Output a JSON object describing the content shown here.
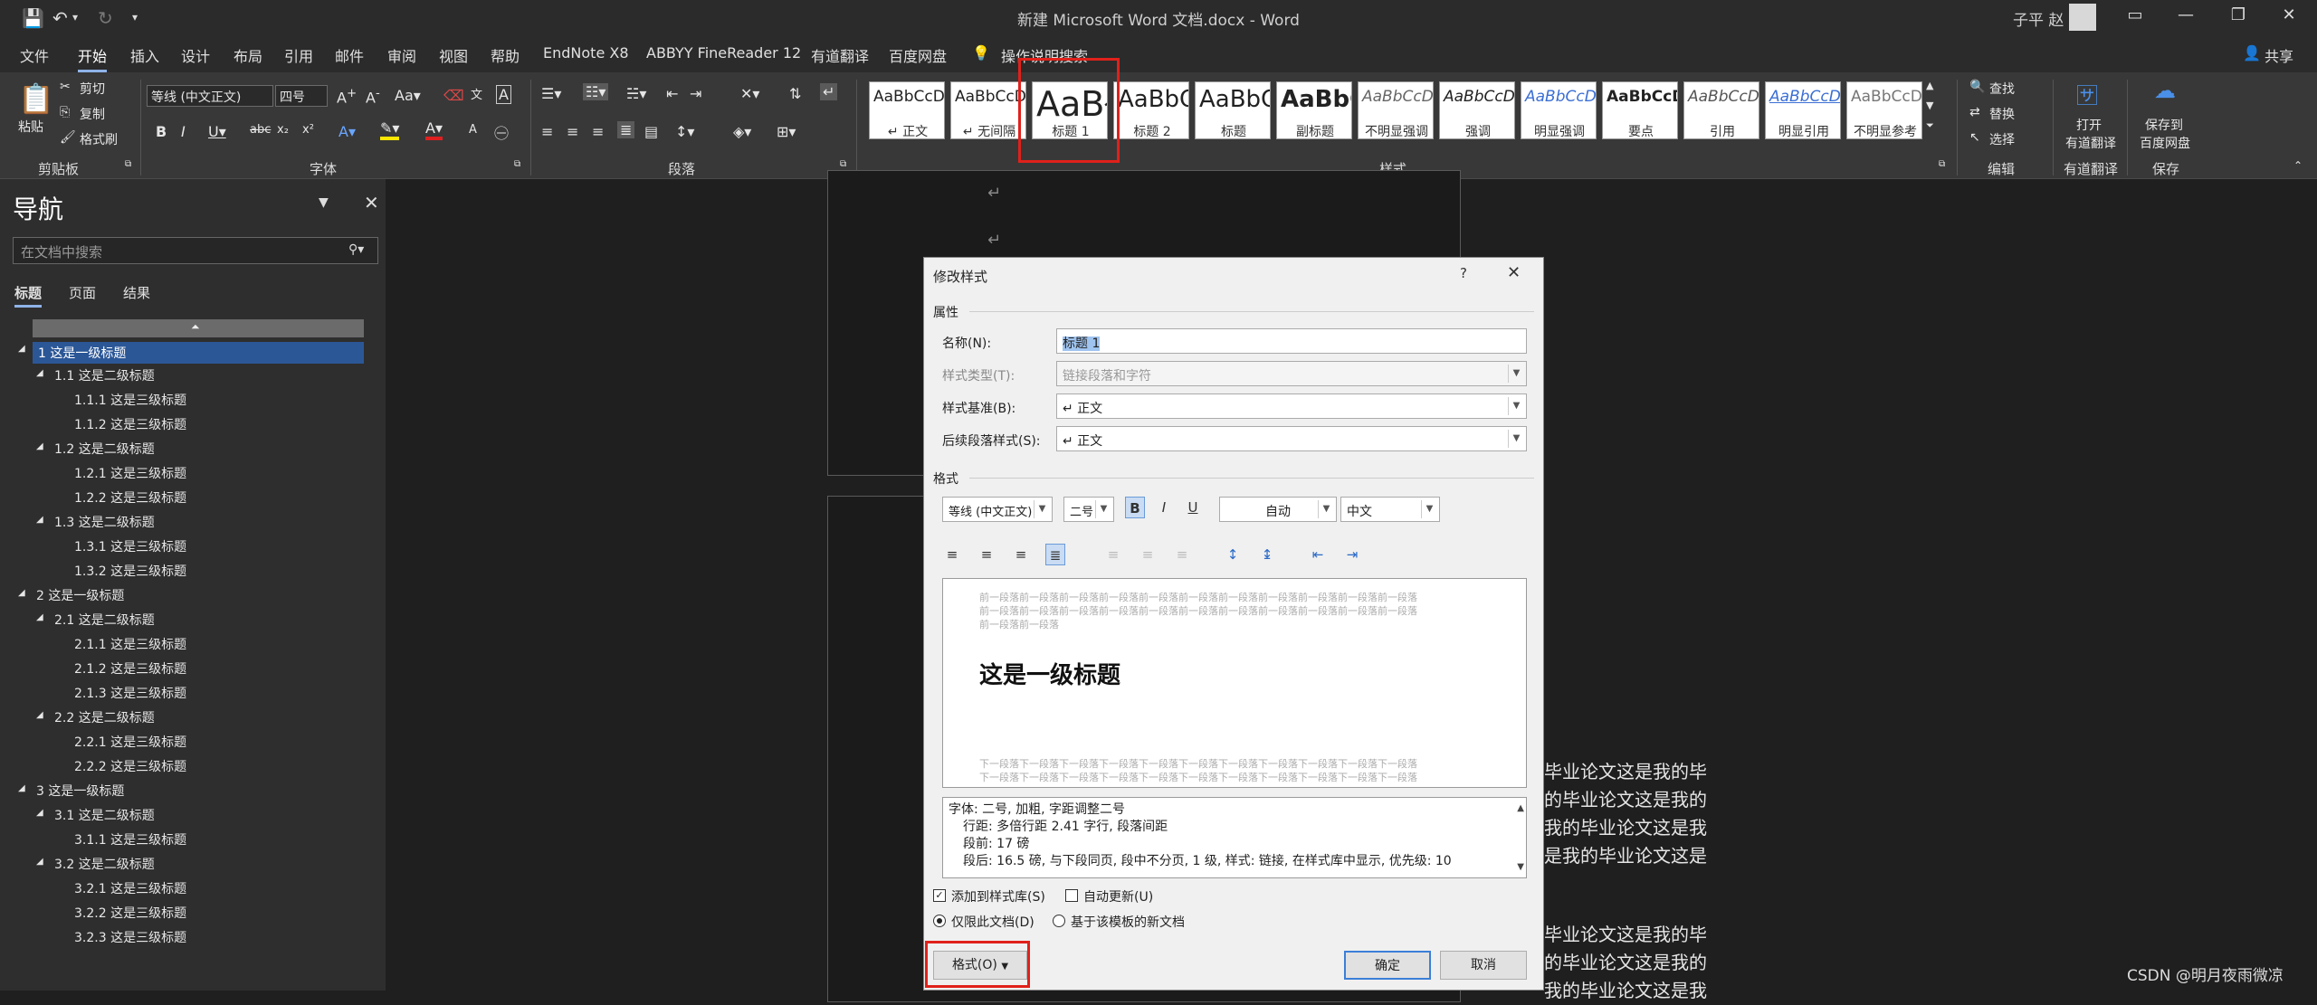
{
  "window": {
    "title": "新建 Microsoft Word 文档.docx - Word",
    "user": "子平 赵"
  },
  "tabs": [
    "文件",
    "开始",
    "插入",
    "设计",
    "布局",
    "引用",
    "邮件",
    "审阅",
    "视图",
    "帮助",
    "EndNote X8",
    "ABBYY FineReader 12",
    "有道翻译",
    "百度网盘"
  ],
  "tell_me": "操作说明搜索",
  "share": "共享",
  "ribbon": {
    "paste": "粘贴",
    "cut": "剪切",
    "copy": "复制",
    "format_painter": "格式刷",
    "clipboard": "剪贴板",
    "font_name": "等线 (中文正文)",
    "font_size": "四号",
    "font_group": "字体",
    "paragraph_group": "段落",
    "styles_group": "样式",
    "styles": [
      {
        "sample": "AaBbCcDc",
        "name": "↵ 正文"
      },
      {
        "sample": "AaBbCcDc",
        "name": "↵ 无间隔"
      },
      {
        "sample": "AaBł",
        "name": "标题 1"
      },
      {
        "sample": "AaBbC",
        "name": "标题 2"
      },
      {
        "sample": "AaBbC",
        "name": "标题"
      },
      {
        "sample": "AaBbC",
        "name": "副标题"
      },
      {
        "sample": "AaBbCcDc",
        "name": "不明显强调"
      },
      {
        "sample": "AaBbCcDc",
        "name": "强调"
      },
      {
        "sample": "AaBbCcDc",
        "name": "明显强调"
      },
      {
        "sample": "AaBbCcD",
        "name": "要点"
      },
      {
        "sample": "AaBbCcDc",
        "name": "引用"
      },
      {
        "sample": "AaBbCcDc",
        "name": "明显引用"
      },
      {
        "sample": "AaBbCcDc",
        "name": "不明显参考"
      }
    ],
    "find": "查找",
    "replace": "替换",
    "select": "选择",
    "edit_group": "编辑",
    "open_translate_1": "打开",
    "open_translate_2": "有道翻译",
    "youdao_group": "有道翻译",
    "save_baidu_1": "保存到",
    "save_baidu_2": "百度网盘",
    "save_group": "保存"
  },
  "nav": {
    "title": "导航",
    "search_placeholder": "在文档中搜索",
    "tabs": [
      "标题",
      "页面",
      "结果"
    ],
    "items": [
      {
        "label": "1 这是一级标题",
        "level": 1
      },
      {
        "label": "1.1 这是二级标题",
        "level": 2
      },
      {
        "label": "1.1.1 这是三级标题",
        "level": 3
      },
      {
        "label": "1.1.2 这是三级标题",
        "level": 3
      },
      {
        "label": "1.2 这是二级标题",
        "level": 2
      },
      {
        "label": "1.2.1 这是三级标题",
        "level": 3
      },
      {
        "label": "1.2.2 这是三级标题",
        "level": 3
      },
      {
        "label": "1.3 这是二级标题",
        "level": 2
      },
      {
        "label": "1.3.1 这是三级标题",
        "level": 3
      },
      {
        "label": "1.3.2 这是三级标题",
        "level": 3
      },
      {
        "label": "2 这是一级标题",
        "level": 1
      },
      {
        "label": "2.1 这是二级标题",
        "level": 2
      },
      {
        "label": "2.1.1 这是三级标题",
        "level": 3
      },
      {
        "label": "2.1.2 这是三级标题",
        "level": 3
      },
      {
        "label": "2.1.3 这是三级标题",
        "level": 3
      },
      {
        "label": "2.2 这是二级标题",
        "level": 2
      },
      {
        "label": "2.2.1 这是三级标题",
        "level": 3
      },
      {
        "label": "2.2.2 这是三级标题",
        "level": 3
      },
      {
        "label": "3 这是一级标题",
        "level": 1
      },
      {
        "label": "3.1 这是二级标题",
        "level": 2
      },
      {
        "label": "3.1.1 这是三级标题",
        "level": 3
      },
      {
        "label": "3.2 这是二级标题",
        "level": 2
      },
      {
        "label": "3.2.1 这是三级标题",
        "level": 3
      },
      {
        "label": "3.2.2 这是三级标题",
        "level": 3
      },
      {
        "label": "3.2.3 这是三级标题",
        "level": 3
      }
    ]
  },
  "doc": {
    "lines_a": [
      "毕业论文这是我的毕",
      "的毕业论文这是我的",
      "我的毕业论文这是我",
      "是我的毕业论文这是"
    ],
    "lines_b": [
      "毕业论文这是我的毕",
      "的毕业论文这是我的",
      "我的毕业论文这是我"
    ]
  },
  "dialog": {
    "title": "修改样式",
    "help": "?",
    "properties": "属性",
    "name_label": "名称(N):",
    "name_value": "标题 1",
    "type_label": "样式类型(T):",
    "type_value": "链接段落和字符",
    "based_label": "样式基准(B):",
    "based_value": "↵ 正文",
    "next_label": "后续段落样式(S):",
    "next_value": "↵ 正文",
    "format": "格式",
    "font": "等线 (中文正文)",
    "size": "二号",
    "color": "自动",
    "lang": "中文",
    "preview_prev": "前一段落前一段落前一段落前一段落前一段落前一段落前一段落前一段落前一段落前一段落前一段落",
    "preview_prev_short": "前一段落前一段落",
    "preview_heading": "这是一级标题",
    "preview_next": "下一段落下一段落下一段落下一段落下一段落下一段落下一段落下一段落下一段落下一段落下一段落",
    "desc1": "字体: 二号, 加粗, 字距调整二号",
    "desc2": "行距: 多倍行距 2.41 字行, 段落间距",
    "desc3": "段前: 17 磅",
    "desc4": "段后: 16.5 磅, 与下段同页, 段中不分页, 1 级, 样式: 链接, 在样式库中显示, 优先级: 10",
    "add_gallery": "添加到样式库(S)",
    "auto_update": "自动更新(U)",
    "only_doc": "仅限此文档(D)",
    "new_template": "基于该模板的新文档",
    "format_btn": "格式(O)",
    "ok": "确定",
    "cancel": "取消"
  },
  "watermark": "CSDN @明月夜雨微凉"
}
